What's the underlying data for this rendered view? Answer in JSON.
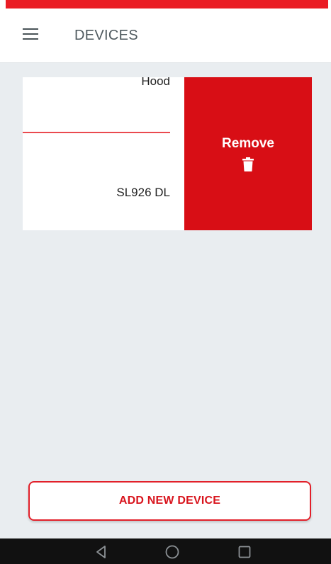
{
  "header": {
    "title": "DEVICES",
    "menu_icon": "hamburger-menu-icon"
  },
  "device_card": {
    "device_type": "Hood",
    "device_model": "SL926 DL",
    "remove_label": "Remove",
    "remove_icon": "trash-icon"
  },
  "actions": {
    "add_device_label": "ADD NEW DEVICE"
  },
  "navigation_bar": {
    "back_icon": "back-triangle-icon",
    "home_icon": "home-circle-icon",
    "recents_icon": "recents-square-icon"
  },
  "colors": {
    "accent_red": "#ea1c24",
    "remove_background": "#d80e15",
    "page_background": "#e9edf0"
  }
}
